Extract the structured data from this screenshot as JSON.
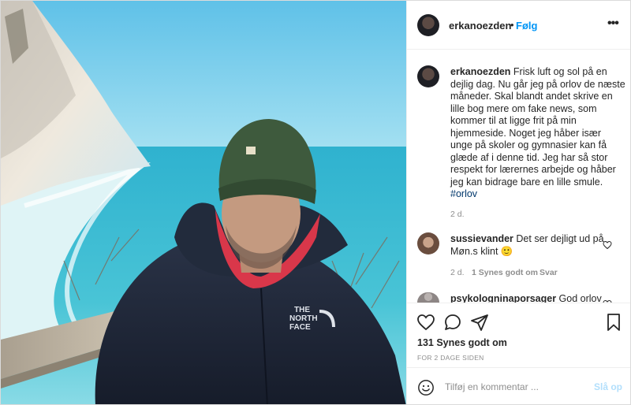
{
  "post": {
    "username": "erkanoezden",
    "follow_dot": "•",
    "follow_label": "Følg",
    "more_label": "•••",
    "caption_text": "Frisk luft og sol på en dejlig dag. Nu går jeg på orlov de næste måneder. Skal blandt andet skrive en lille bog mere om fake news, som kommer til at ligge frit på min hjemmeside. Noget jeg håber især unge på skoler og gymnasier kan få glæde af i denne tid. Jeg har så stor respekt for lærernes arbejde og håber jeg kan bidrage bare en lille smule.",
    "hashtag": "#orlov",
    "caption_age": "2 d.",
    "likes": "131 Synes godt om",
    "date": "FOR 2 DAGE SIDEN"
  },
  "comments": [
    {
      "username": "sussievander",
      "text": "Det ser dejligt ud på Møn.s klint",
      "emoji": "🙂",
      "age": "2 d.",
      "likes": "1 Synes godt om",
      "reply": "Svar"
    },
    {
      "username": "psykologninaporsager",
      "text": "God orlov"
    }
  ],
  "add_comment": {
    "placeholder": "Tilføj en kommentar ...",
    "post_label": "Slå op"
  },
  "icons": [
    "heart-icon",
    "comment-icon",
    "share-icon",
    "bookmark-icon",
    "emoji-icon",
    "more-icon"
  ],
  "colors": {
    "link_blue": "#0095f6",
    "disabled_blue": "#b2dffc",
    "hashtag": "#00376b",
    "muted": "#8e8e8e"
  }
}
